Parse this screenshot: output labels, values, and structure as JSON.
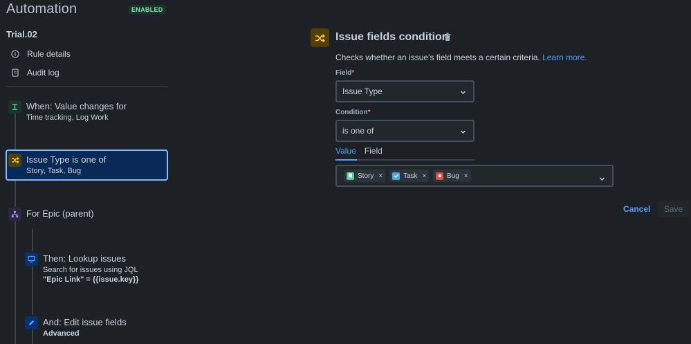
{
  "header": {
    "title": "Automation",
    "status_badge": "ENABLED"
  },
  "sidebar": {
    "rule_name": "Trial.02",
    "menu": [
      {
        "label": "Rule details",
        "icon": "info-icon"
      },
      {
        "label": "Audit log",
        "icon": "audit-log-icon"
      }
    ],
    "flow": [
      {
        "title": "When: Value changes for",
        "subtitle": "Time tracking, Log Work",
        "icon": "trigger-icon",
        "color": "#4bce97"
      },
      {
        "title": "Issue Type is one of",
        "subtitle": "Story, Task, Bug",
        "icon": "shuffle-icon",
        "color": "#f5cd47",
        "selected": true
      },
      {
        "title": "For Epic (parent)",
        "icon": "hierarchy-icon",
        "color": "#9f8fef"
      },
      {
        "title": "Then: Lookup issues",
        "subtitle": "Search for issues using JQL",
        "detail": "\"Epic Link\" = {{issue.key}}",
        "icon": "monitor-icon",
        "color": "#579dff"
      },
      {
        "title": "And: Edit issue fields",
        "detail": "Advanced",
        "icon": "pencil-icon",
        "color": "#579dff"
      }
    ]
  },
  "panel": {
    "title": "Issue fields condition",
    "description": "Checks whether an issue's field meets a certain criteria.",
    "learn_more": "Learn more.",
    "field_label": "Field",
    "field_value": "Issue Type",
    "condition_label": "Condition",
    "condition_value": "is one of",
    "required_mark": "*",
    "tabs": [
      "Value",
      "Field"
    ],
    "active_tab": "Value",
    "values": [
      {
        "label": "Story",
        "color": "#4bce97",
        "icon": "story-icon"
      },
      {
        "label": "Task",
        "color": "#4ba9e3",
        "icon": "task-icon"
      },
      {
        "label": "Bug",
        "color": "#e2483d",
        "icon": "bug-icon"
      }
    ],
    "chip_remove": "×",
    "cancel_label": "Cancel",
    "save_label": "Save"
  }
}
